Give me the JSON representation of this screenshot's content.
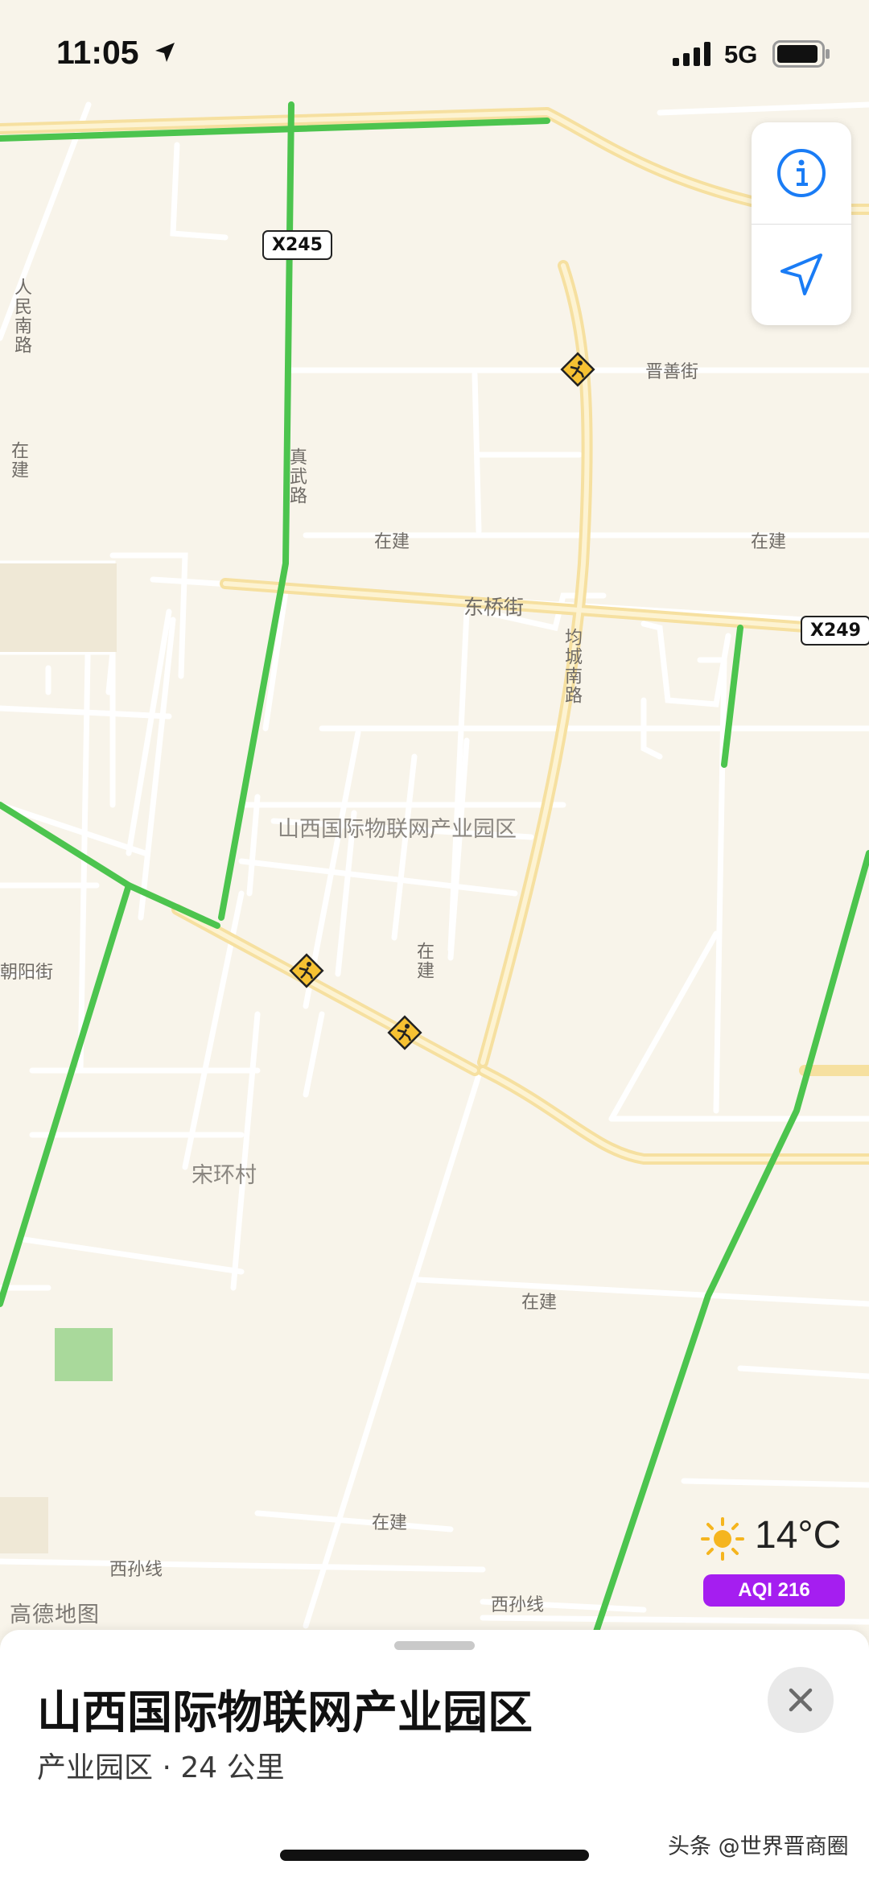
{
  "status_bar": {
    "time": "11:05",
    "network": "5G",
    "icons": [
      "location-arrow-icon",
      "signal-bars-icon",
      "battery-icon"
    ]
  },
  "map": {
    "provider": "高德地图",
    "area_label": "山西国际物联网产业园区",
    "road_labels": {
      "renmin_nan": "人民南路",
      "jinshan": "晋善街",
      "zhenwu": "真武路",
      "zaijian_left": "在建",
      "zaijian_mid": "在建",
      "zaijian_right": "在建",
      "dongqiao": "东桥街",
      "juncheng_nan": "均城南路",
      "chaoyang": "朝阳街",
      "zaijian_diag": "在建",
      "songhuan": "宋环村",
      "zaijian_low1": "在建",
      "zaijian_low2": "在建",
      "xisun_1": "西孙线",
      "xisun_2": "西孙线"
    },
    "shields": {
      "x245": "X245",
      "x249": "X249"
    },
    "markers": [
      "construction-warning-icon",
      "construction-warning-icon",
      "construction-warning-icon"
    ],
    "colors": {
      "background": "#f8f4ea",
      "major_road": "#fbe9b0",
      "green_route": "#4cc44e",
      "minor_road": "#ffffff"
    }
  },
  "controls": {
    "info": "info-icon",
    "locate": "locate-arrow-icon"
  },
  "weather": {
    "temperature": "14°C",
    "aqi": "AQI 216",
    "icon": "sun-icon",
    "aqi_color": "#a51ef0"
  },
  "sheet": {
    "title": "山西国际物联网产业园区",
    "subtitle": "产业园区 · 24 公里",
    "close_icon": "close-icon",
    "watermark": "头条 @世界晋商圈"
  }
}
